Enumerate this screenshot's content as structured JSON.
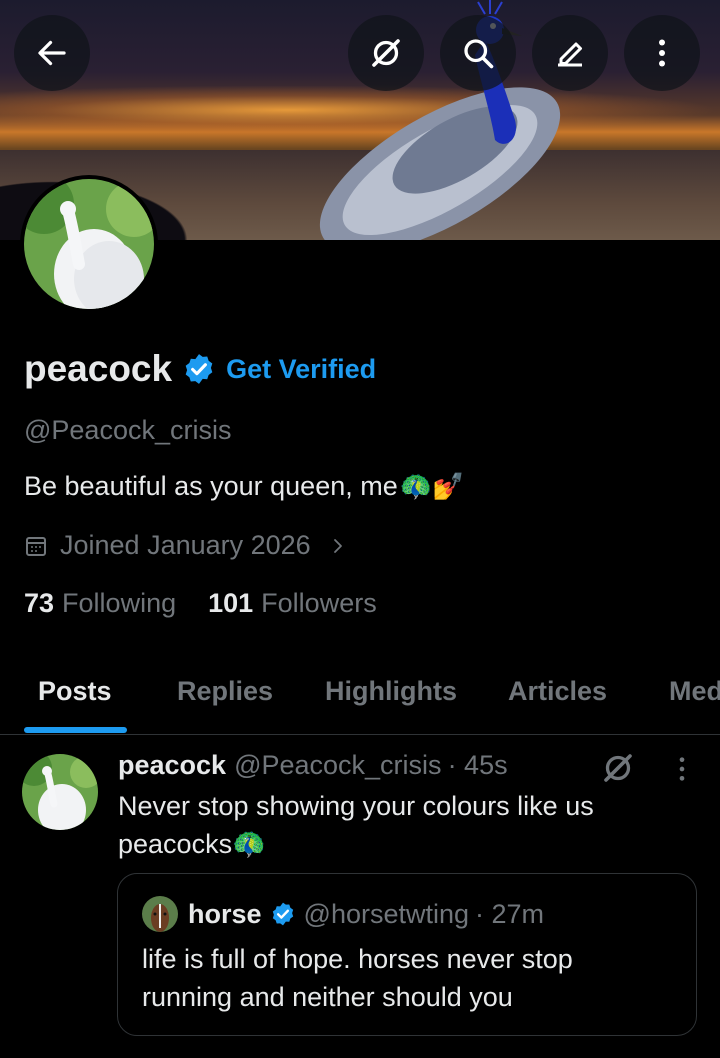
{
  "header": {
    "back_icon": "arrow-left-icon",
    "grok_icon": "grok-icon",
    "search_icon": "search-icon",
    "edit_icon": "pencil-icon",
    "more_icon": "more-vertical-icon"
  },
  "profile": {
    "display_name": "peacock",
    "get_verified_label": "Get Verified",
    "handle": "@Peacock_crisis",
    "bio": "Be beautiful as your queen, me",
    "bio_emoji": "🦚💅",
    "joined": "Joined January 2026",
    "following_count": "73",
    "following_label": "Following",
    "followers_count": "101",
    "followers_label": "Followers"
  },
  "tabs": [
    {
      "label": "Posts"
    },
    {
      "label": "Replies"
    },
    {
      "label": "Highlights"
    },
    {
      "label": "Articles"
    },
    {
      "label": "Media"
    }
  ],
  "post": {
    "author_name": "peacock",
    "author_handle": "@Peacock_crisis",
    "time": "· 45s",
    "text": "Never stop showing your colours like us peacocks🦚",
    "quote": {
      "author_name": "horse",
      "author_handle": "@horsetwting",
      "time": "· 27m",
      "text": "life is full of hope. horses never stop running and neither should you"
    }
  },
  "colors": {
    "accent": "#1d9bf0",
    "muted": "#71767b",
    "text": "#e7e9ea",
    "background": "#000000"
  }
}
